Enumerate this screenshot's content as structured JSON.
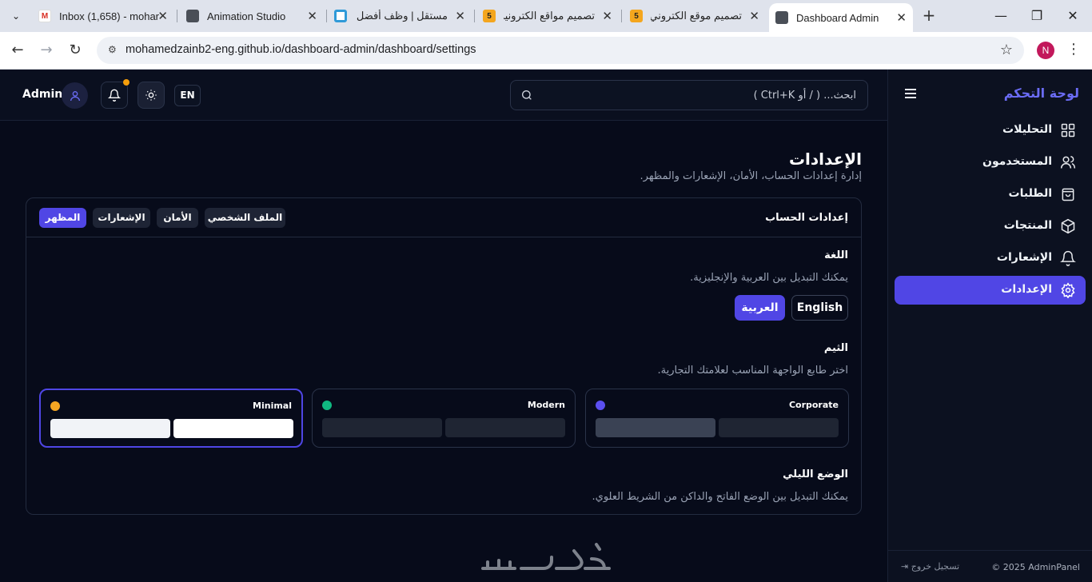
{
  "browser": {
    "tabs": [
      {
        "title": "Inbox (1,658) - mohar",
        "icon": "gmail-icon"
      },
      {
        "title": "Animation Studio",
        "icon": "globe-icon"
      },
      {
        "title": "مستقل | وظف أفضل ا",
        "icon": "ring-icon"
      },
      {
        "title": "تصميم مواقع الكترونيه",
        "icon": "five-icon",
        "icon_text": "5"
      },
      {
        "title": "تصميم موقع الكتروني",
        "icon": "five-icon",
        "icon_text": "5"
      },
      {
        "title": "Dashboard Admin",
        "icon": "globe-icon",
        "active": true
      }
    ],
    "url": "mohamedzainb2-eng.github.io/dashboard-admin/dashboard/settings",
    "profile_initial": "N"
  },
  "topbar": {
    "admin_name": "Admin",
    "lang_toggle": "EN",
    "search_placeholder": "ابحث... ( / أو Ctrl+K )"
  },
  "sidebar": {
    "brand": "لوحة التحكم",
    "items": [
      {
        "label": "التحليلات",
        "icon": "grid-icon"
      },
      {
        "label": "المستخدمون",
        "icon": "users-icon"
      },
      {
        "label": "الطلبات",
        "icon": "bag-icon"
      },
      {
        "label": "المنتجات",
        "icon": "box-icon"
      },
      {
        "label": "الإشعارات",
        "icon": "bell-icon"
      },
      {
        "label": "الإعدادات",
        "icon": "gear-icon",
        "active": true
      }
    ],
    "footer_copy": "© 2025 AdminPanel",
    "logout": "تسجيل خروج"
  },
  "page": {
    "title": "الإعدادات",
    "subtitle": "إدارة إعدادات الحساب، الأمان، الإشعارات والمظهر."
  },
  "card": {
    "title": "إعدادات الحساب",
    "tabs": [
      "الملف الشخصي",
      "الأمان",
      "الإشعارات",
      "المظهر"
    ],
    "active_tab": "المظهر",
    "language": {
      "title": "اللغة",
      "desc": "يمكنك التبديل بين العربية والإنجليزية.",
      "options": [
        "English",
        "العربية"
      ],
      "selected": "العربية"
    },
    "theme": {
      "title": "الثيم",
      "desc": "اختر طابع الواجهة المناسب لعلامتك التجارية.",
      "options": [
        {
          "name": "Corporate",
          "dot": "#5b4ff0",
          "swatch_a": "#3a4254",
          "swatch_b": "#1f2533"
        },
        {
          "name": "Modern",
          "dot": "#10b981",
          "swatch_a": "#1f2533",
          "swatch_b": "#1f2533"
        },
        {
          "name": "Minimal",
          "dot": "#f5a623",
          "swatch_a": "#f1f3f7",
          "swatch_b": "#ffffff",
          "selected": true
        }
      ]
    },
    "dark_mode": {
      "title": "الوضع الليلي",
      "desc": "يمكنك التبديل بين الوضع الفاتح والداكن من الشريط العلوي."
    }
  },
  "colors": {
    "accent": "#5046e5",
    "background": "#070b1a",
    "notification_dot": "#f59e0b"
  }
}
